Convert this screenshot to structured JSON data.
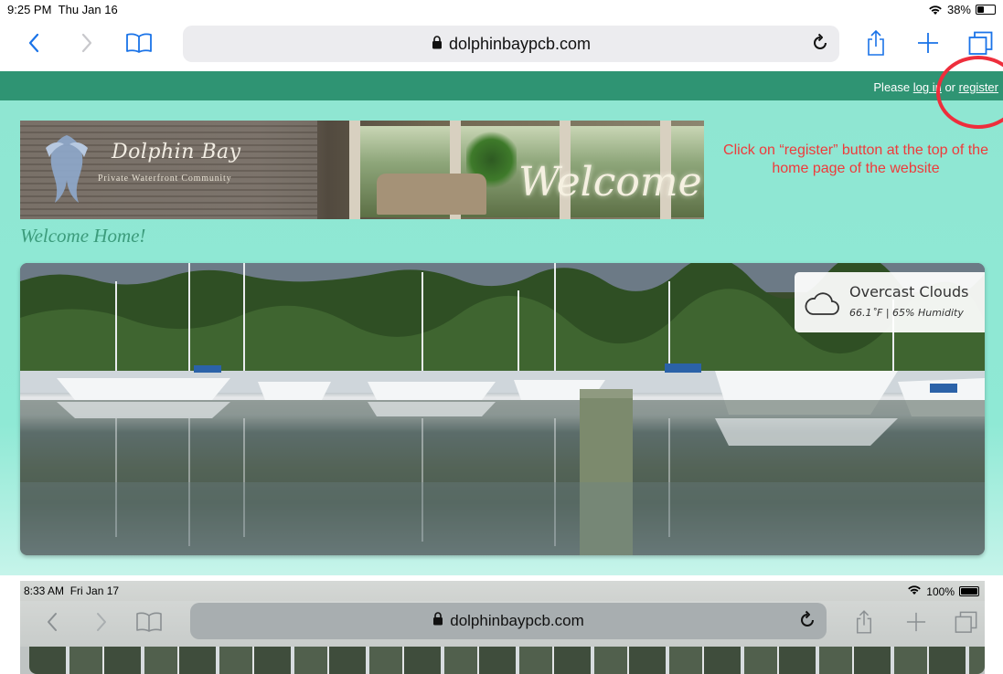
{
  "status_bar_1": {
    "time": "9:25 PM",
    "date": "Thu Jan 16",
    "battery": "38%",
    "battery_level": 0.38
  },
  "browser_1": {
    "url": "dolphinbaypcb.com",
    "icons": {
      "back": "chevron-left-icon",
      "forward": "chevron-right-icon",
      "bookmarks": "book-icon",
      "lock": "lock-icon",
      "reload": "reload-icon",
      "share": "share-icon",
      "new_tab": "plus-icon",
      "tabs": "tabs-icon"
    },
    "accent_color": "#1a73e8"
  },
  "site": {
    "login_prefix": "Please ",
    "login_link": "log in",
    "login_middle": " or ",
    "register_link": "register",
    "header_color": "#2f9473",
    "background_color": "#8fe6d2",
    "banner": {
      "brand": "Dolphin Bay",
      "tagline": "Private Waterfront Community",
      "welcome": "Welcome."
    },
    "welcome_home": "Welcome Home!",
    "weather": {
      "icon": "cloud-icon",
      "condition": "Overcast Clouds",
      "detail": "66.1˚F | 65% Humidity"
    }
  },
  "annotation": {
    "text": "Click on “register” button at the top of the home page of the website",
    "color": "#ef3a3a"
  },
  "status_bar_2": {
    "time": "8:33 AM",
    "date": "Fri Jan 17",
    "battery": "100%",
    "battery_level": 1.0
  },
  "browser_2": {
    "url": "dolphinbaypcb.com"
  }
}
